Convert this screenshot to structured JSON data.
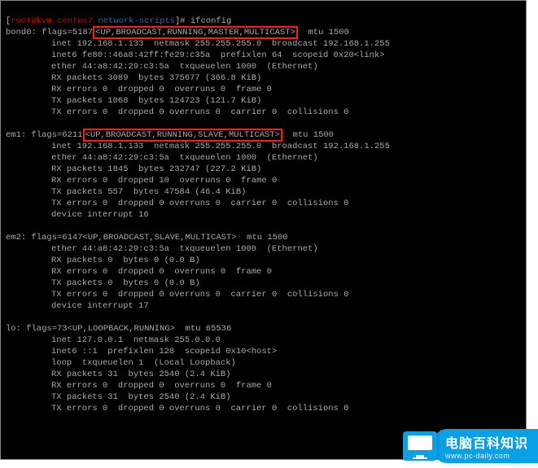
{
  "prompt": {
    "userhost": "root@kvm-centos7",
    "cwd": "network-scripts",
    "command": "ifconfig"
  },
  "ifaces": {
    "bond0": {
      "header_pre": "bond0: flags=5187",
      "flags_hl": "<UP,BROADCAST,RUNNING,MASTER,MULTICAST>",
      "header_post": "  mtu 1500",
      "lines": [
        "inet 192.168.1.133  netmask 255.255.255.0  broadcast 192.168.1.255",
        "inet6 fe80::46a8:42ff:fe29:c35a  prefixlen 64  scopeid 0x20<link>",
        "ether 44:a8:42:29:c3:5a  txqueuelen 1000  (Ethernet)",
        "RX packets 3089  bytes 375677 (366.8 KiB)",
        "RX errors 0  dropped 0  overruns 0  frame 0",
        "TX packets 1068  bytes 124723 (121.7 KiB)",
        "TX errors 0  dropped 0 overruns 0  carrier 0  collisions 0"
      ]
    },
    "em1": {
      "header_pre": "em1: flags=6211",
      "flags_hl": "<UP,BROADCAST,RUNNING,SLAVE,MULTICAST>",
      "header_post": "  mtu 1500",
      "lines": [
        "inet 192.168.1.133  netmask 255.255.255.0  broadcast 192.168.1.255",
        "ether 44:a8:42:29:c3:5a  txqueuelen 1000  (Ethernet)",
        "RX packets 1845  bytes 232747 (227.2 KiB)",
        "RX errors 0  dropped 10  overruns 0  frame 0",
        "TX packets 557  bytes 47584 (46.4 KiB)",
        "TX errors 0  dropped 0 overruns 0  carrier 0  collisions 0",
        "device interrupt 16"
      ]
    },
    "em2": {
      "header": "em2: flags=6147<UP,BROADCAST,SLAVE,MULTICAST>  mtu 1500",
      "lines": [
        "ether 44:a8:42:29:c3:5a  txqueuelen 1000  (Ethernet)",
        "RX packets 0  bytes 0 (0.0 B)",
        "RX errors 0  dropped 0  overruns 0  frame 0",
        "TX packets 0  bytes 0 (0.0 B)",
        "TX errors 0  dropped 0 overruns 0  carrier 0  collisions 0",
        "device interrupt 17"
      ]
    },
    "lo": {
      "header": "lo: flags=73<UP,LOOPBACK,RUNNING>  mtu 65536",
      "lines": [
        "inet 127.0.0.1  netmask 255.0.0.0",
        "inet6 ::1  prefixlen 128  scopeid 0x10<host>",
        "loop  txqueuelen 1  (Local Loopback)",
        "RX packets 31  bytes 2540 (2.4 KiB)",
        "RX errors 0  dropped 0  overruns 0  frame 0",
        "TX packets 31  bytes 2540 (2.4 KiB)",
        "TX errors 0  dropped 0 overruns 0  carrier 0  collisions 0"
      ]
    }
  },
  "watermark": {
    "title": "电脑百科知识",
    "url": "www.pc-daily.com"
  }
}
